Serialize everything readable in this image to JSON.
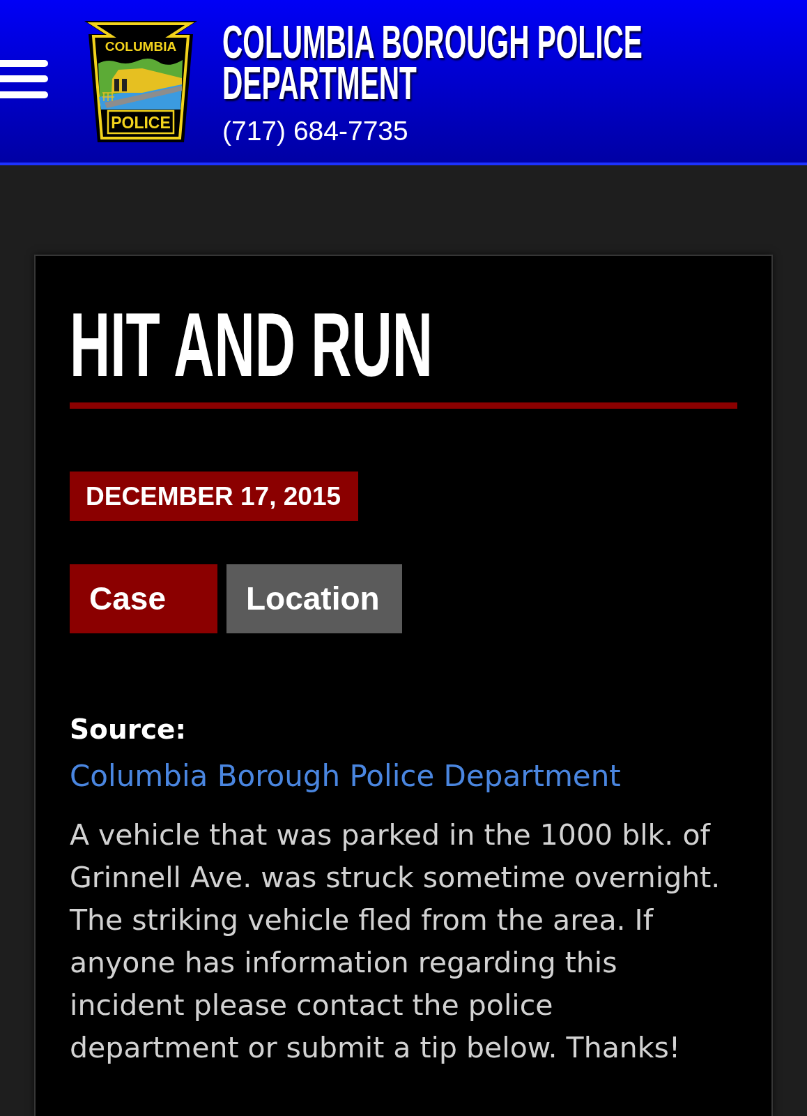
{
  "header": {
    "logo": {
      "top_text": "COLUMBIA",
      "bottom_text": "POLICE"
    },
    "title": "COLUMBIA BOROUGH POLICE DEPARTMENT",
    "phone": "(717) 684-7735"
  },
  "article": {
    "title": "HIT AND RUN",
    "date": "DECEMBER 17, 2015",
    "tabs": [
      {
        "label": "Case",
        "selected": true
      },
      {
        "label": "Location",
        "selected": false
      }
    ],
    "source_label": "Source:",
    "source_link": "Columbia Borough Police Department",
    "body": "A vehicle that was parked in the 1000 blk. of Grinnell Ave. was struck sometime overnight. The striking vehicle fled from the area. If anyone has information regarding this incident please contact the police department or submit a tip below. Thanks!"
  }
}
